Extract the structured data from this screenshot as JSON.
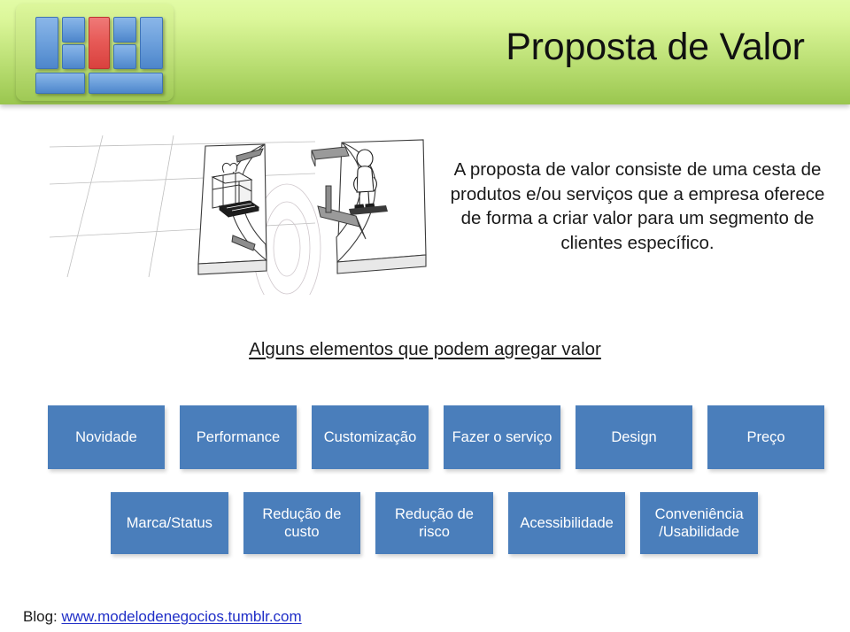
{
  "header": {
    "title": "Proposta de Valor",
    "logo": {
      "name": "business-model-blocks-logo",
      "accent_color": "#e75b58",
      "block_color": "#6fa2dd",
      "plate_color": "#c3e37e"
    },
    "band_gradient_top": "#dcf79a",
    "band_gradient_bottom": "#9ac64f"
  },
  "illustration": {
    "name": "value-proposition-sketch",
    "description": "Sketch of two separated platforms, a gift box on the left platform and a standing person on the right platform"
  },
  "main": {
    "intro_paragraph": "A proposta de valor consiste de uma cesta de produtos e/ou serviços que a empresa oferece de forma a criar valor para um segmento de clientes específico.",
    "section_heading": "Alguns elementos que podem agregar valor",
    "box_color": "#4a7ebb",
    "box_text_color": "#ffffff",
    "rows": [
      {
        "row_name": "elements-row-one",
        "boxes": [
          {
            "label": "Novidade"
          },
          {
            "label": "Performance"
          },
          {
            "label": "Customização"
          },
          {
            "label": "Fazer o serviço"
          },
          {
            "label": "Design"
          },
          {
            "label": "Preço"
          }
        ]
      },
      {
        "row_name": "elements-row-two",
        "boxes": [
          {
            "label": "Marca/Status"
          },
          {
            "label": "Redução de custo"
          },
          {
            "label": "Redução de risco"
          },
          {
            "label": "Acessibilidade"
          },
          {
            "label": "Conveniência /Usabilidade"
          }
        ]
      }
    ]
  },
  "footer": {
    "prefix": "Blog: ",
    "link_text": "www.modelodenegocios.tumblr.com",
    "link_color": "#1f2ec7"
  }
}
